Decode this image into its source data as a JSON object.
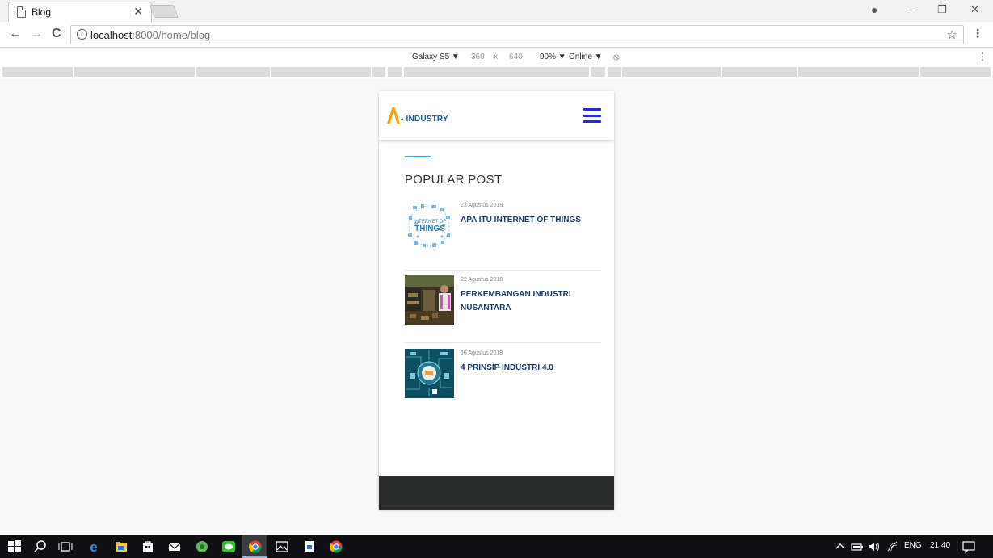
{
  "browser": {
    "tab_title": "Blog",
    "tab_close": "✕",
    "url_host": "localhost",
    "url_rest": ":8000/home/blog",
    "controls": {
      "minimize": "—",
      "restore": "❐",
      "close": "✕",
      "back": "←",
      "forward": "→",
      "reload": "C",
      "star": "☆",
      "menu": "⋮",
      "profile": "●"
    }
  },
  "device_toolbar": {
    "device": "Galaxy S5 ▼",
    "width": "360",
    "x": "x",
    "height": "640",
    "zoom": "90% ▼",
    "network": "Online ▼",
    "rotate": "⦸",
    "menu": "⋮"
  },
  "site": {
    "logo_text": "- INDUSTRY",
    "brand_color": "#f6a400",
    "section_title": "POPULAR POST",
    "posts": [
      {
        "date": "23 Agustus 2018",
        "title": "APA ITU INTERNET OF THINGS",
        "thumb_text_1": "INTERNET OF",
        "thumb_text_2": "THINGS"
      },
      {
        "date": "22 Agustus 2018",
        "title": "PERKEMBANGAN INDUSTRI NUSANTARA"
      },
      {
        "date": "16 Agustus 2018",
        "title": "4 PRINSIP INDUSTRI 4.0"
      }
    ]
  },
  "taskbar": {
    "language": "ENG",
    "time": "21:40"
  }
}
